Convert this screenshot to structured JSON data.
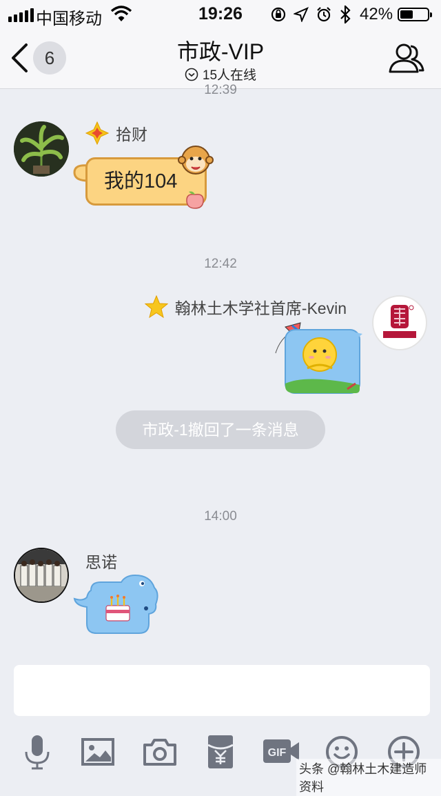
{
  "status_bar": {
    "carrier": "中国移动",
    "time": "19:26",
    "battery_percent": "42%",
    "battery_level": 0.42
  },
  "nav": {
    "unread_count": "6",
    "title": "市政-VIP",
    "online_status": "15人在线"
  },
  "messages": {
    "top_partial_time": "12:39",
    "msg1": {
      "sender": "拾财",
      "text": "我的104"
    },
    "time2": "12:42",
    "msg2": {
      "sender": "翰林土木学社首席-Kevin"
    },
    "recall_notice": "市政-1撤回了一条消息",
    "time3": "14:00",
    "msg3": {
      "sender": "思诺"
    }
  },
  "input": {
    "value": ""
  },
  "toolbar": {
    "gif_label": "GIF",
    "items": [
      "microphone-icon",
      "image-icon",
      "camera-icon",
      "red-packet-icon",
      "gif-icon",
      "emoji-icon",
      "plus-icon"
    ]
  },
  "watermark": "头条 @翰林土木建造师资料",
  "colors": {
    "background": "#eceef3",
    "bubble_yellow": "#fcd482",
    "bubble_blue": "#8dc6f2",
    "recall_bg": "#d3d5db"
  }
}
